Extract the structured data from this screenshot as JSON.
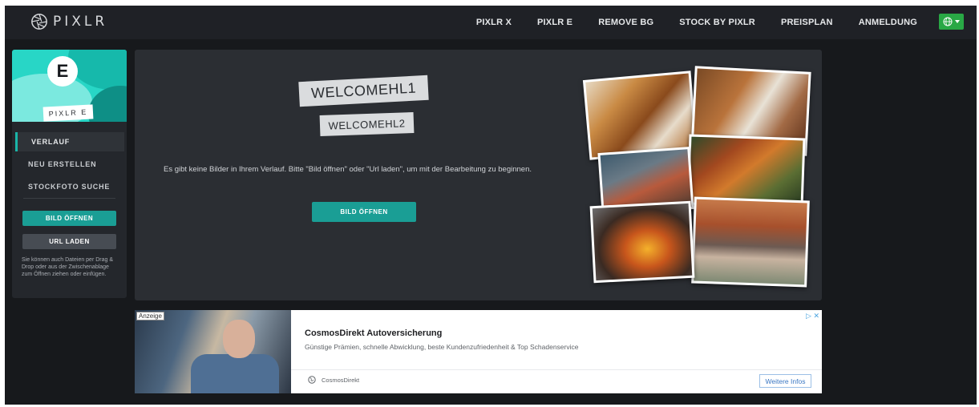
{
  "logo": {
    "text": "PIXLR"
  },
  "nav": {
    "items": [
      "PIXLR X",
      "PIXLR E",
      "REMOVE BG",
      "STOCK BY PIXLR",
      "PREISPLAN",
      "ANMELDUNG"
    ],
    "language_icon": "globe-icon"
  },
  "sidebar": {
    "app_letter": "E",
    "app_badge": "PIXLR E",
    "menu": [
      "VERLAUF",
      "NEU ERSTELLEN",
      "STOCKFOTO SUCHE"
    ],
    "active_index": 0,
    "open_button": "BILD ÖFFNEN",
    "url_button": "URL LADEN",
    "note": "Sie können auch Dateien per Drag & Drop oder aus der Zwischenablage zum Öffnen ziehen oder einfügen."
  },
  "main": {
    "tag1": "WELCOMEHL1",
    "tag2": "WELCOMEHL2",
    "empty_message": "Es gibt keine Bilder in Ihrem Verlauf. Bitte \"Bild öffnen\" oder \"Url laden\", um mit der Bearbeitung zu beginnen.",
    "open_button": "BILD ÖFFNEN"
  },
  "ad": {
    "label": "Anzeige",
    "title": "CosmosDirekt Autoversicherung",
    "description": "Günstige Prämien, schnelle Abwicklung, beste Kundenzufriedenheit & Top Schadenservice",
    "source": "CosmosDirekt",
    "cta": "Weitere Infos",
    "choices": "▷ ✕"
  },
  "colors": {
    "accent": "#1a9e95",
    "nav_bg": "#1f2126",
    "globe_button": "#29a845"
  }
}
